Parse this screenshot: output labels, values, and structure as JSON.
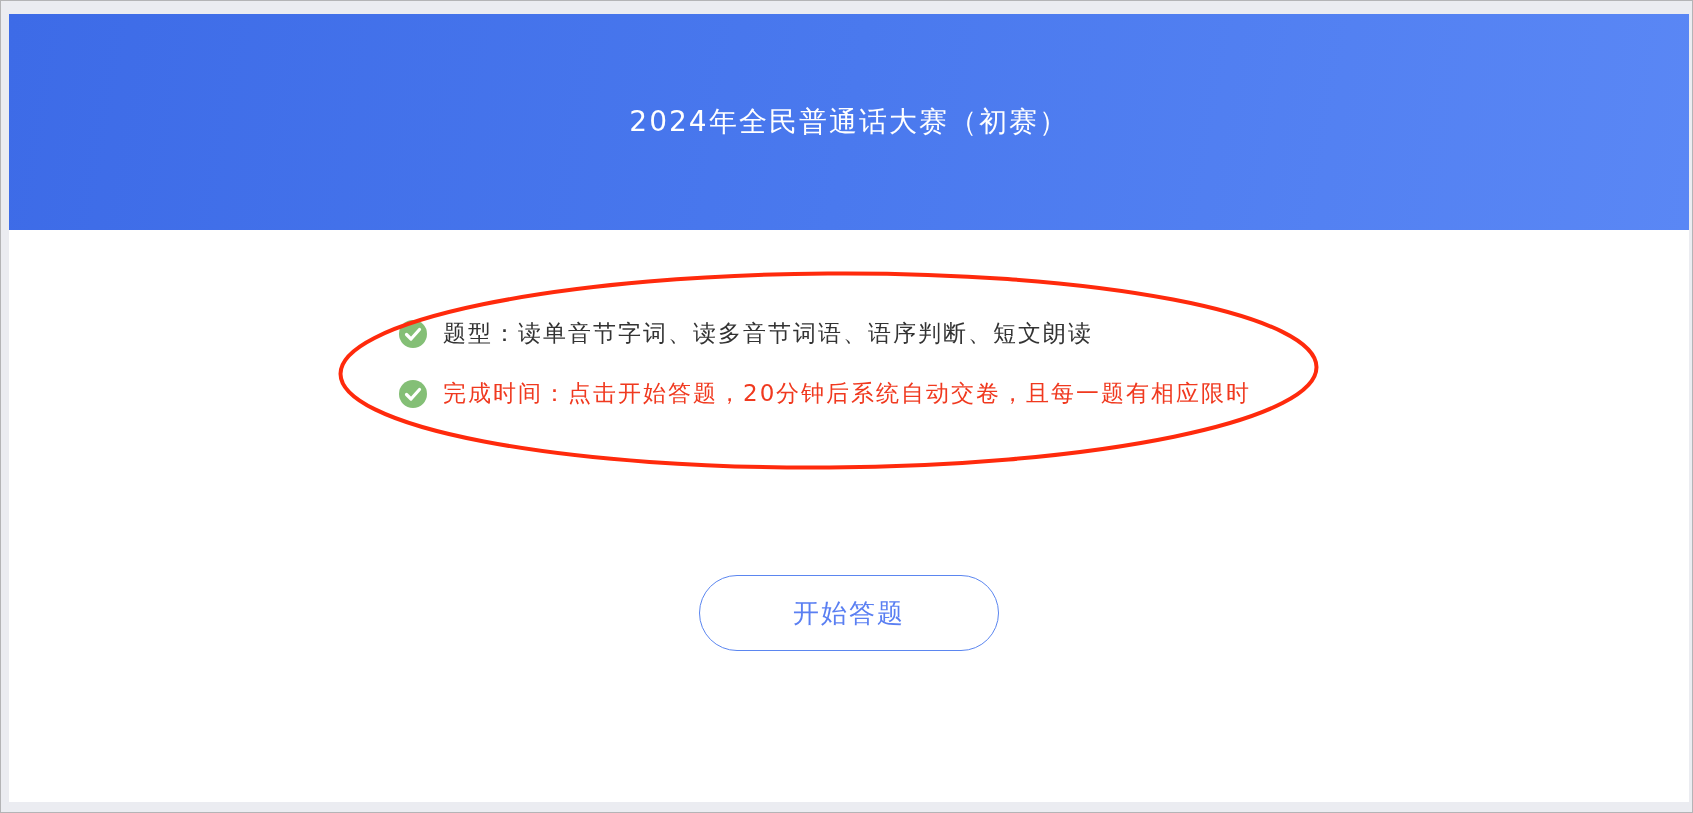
{
  "header": {
    "title": "2024年全民普通话大赛（初赛）"
  },
  "rules": [
    {
      "text": "题型：读单音节字词、读多音节词语、语序判断、短文朗读",
      "highlighted": false
    },
    {
      "text": "完成时间：点击开始答题，20分钟后系统自动交卷，且每一题有相应限时",
      "highlighted": true
    }
  ],
  "start_button": {
    "label": "开始答题"
  }
}
